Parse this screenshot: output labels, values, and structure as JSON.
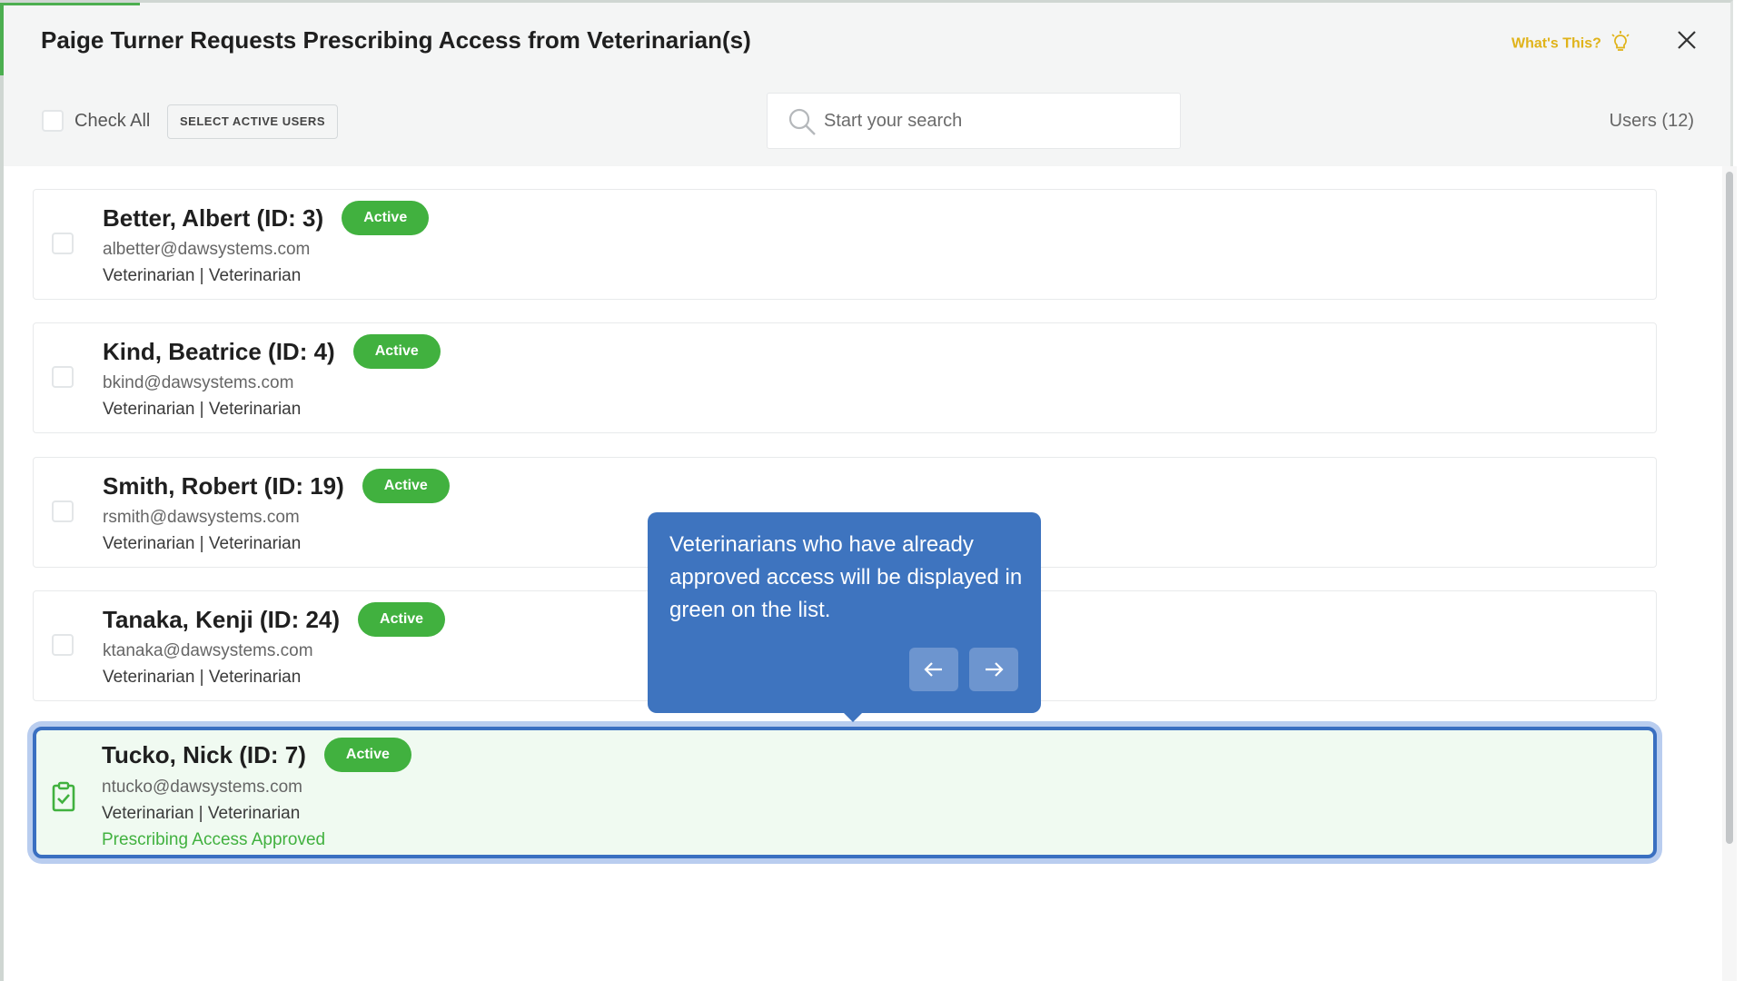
{
  "modal": {
    "title": "Paige Turner Requests Prescribing Access from Veterinarian(s)",
    "whats_this": "What's This?",
    "close_icon": "close-icon"
  },
  "toolbar": {
    "check_all_label": "Check All",
    "select_active_label": "SELECT ACTIVE USERS",
    "search_placeholder": "Start your search",
    "search_value": "",
    "users_count": "Users (12)"
  },
  "users": [
    {
      "name": "Better, Albert (ID: 3)",
      "status": "Active",
      "email": "albetter@dawsystems.com",
      "role": "Veterinarian | Veterinarian"
    },
    {
      "name": "Kind, Beatrice (ID: 4)",
      "status": "Active",
      "email": "bkind@dawsystems.com",
      "role": "Veterinarian | Veterinarian"
    },
    {
      "name": "Smith, Robert (ID: 19)",
      "status": "Active",
      "email": "rsmith@dawsystems.com",
      "role": "Veterinarian | Veterinarian"
    },
    {
      "name": "Tanaka, Kenji (ID: 24)",
      "status": "Active",
      "email": "ktanaka@dawsystems.com",
      "role": "Veterinarian | Veterinarian"
    },
    {
      "name": "Tucko, Nick (ID: 7)",
      "status": "Active",
      "email": "ntucko@dawsystems.com",
      "role": "Veterinarian | Veterinarian",
      "approval": "Prescribing Access Approved"
    }
  ],
  "tooltip": {
    "text": "Veterinarians who have already approved access will be displayed in green on the list."
  },
  "colors": {
    "active_badge": "#41b13f",
    "tooltip_bg": "#3e74bf",
    "highlight_border": "#3a6fc1",
    "whats_this": "#e0b31a"
  }
}
